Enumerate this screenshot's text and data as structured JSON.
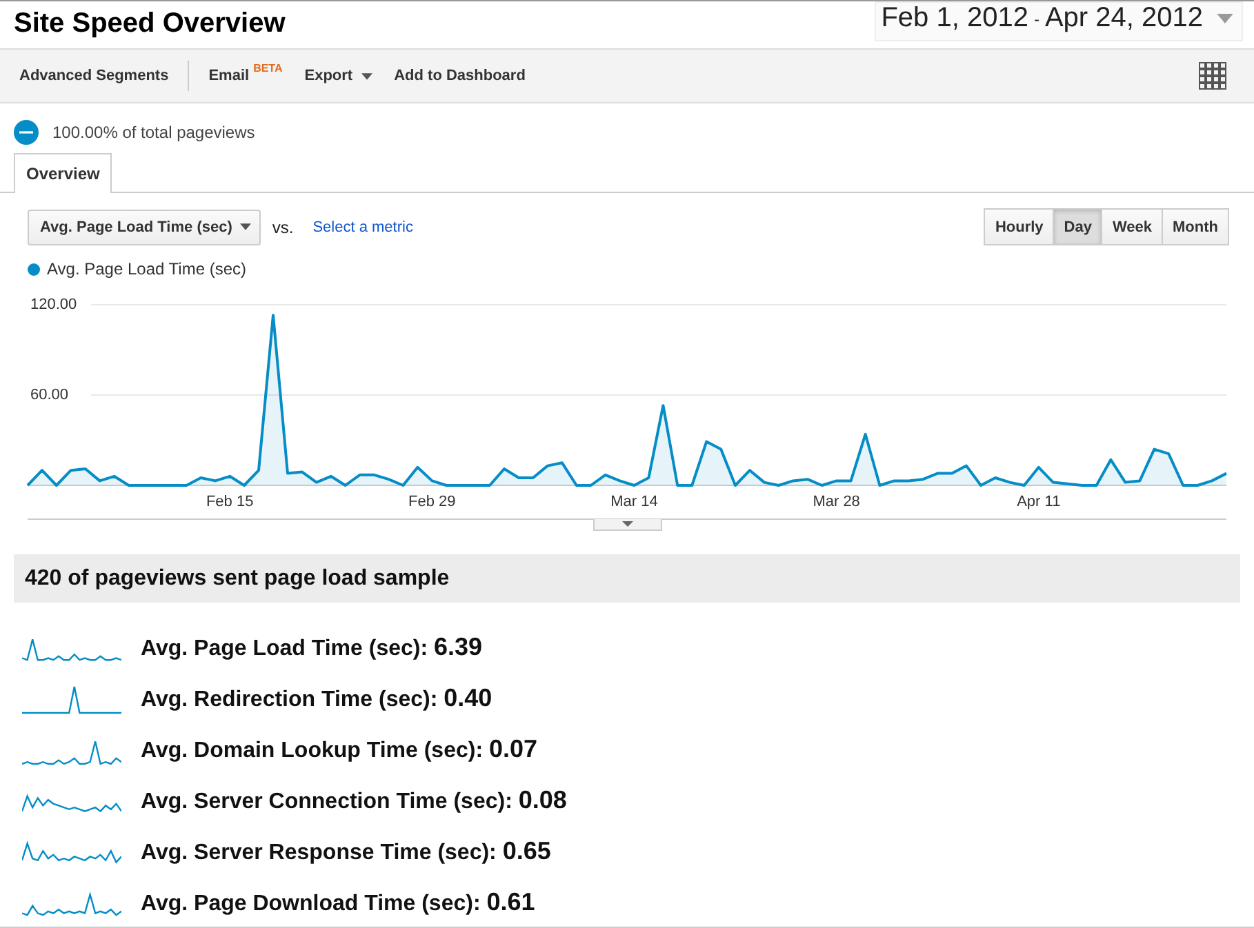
{
  "title": "Site Speed Overview",
  "date_range": {
    "start": "Feb 1, 2012",
    "separator": "-",
    "end": "Apr 24, 2012"
  },
  "toolbar": [
    {
      "label": "Advanced Segments",
      "kind": "plain"
    },
    {
      "label": "Email",
      "badge": "BETA",
      "kind": "badge"
    },
    {
      "label": "Export",
      "kind": "menu"
    },
    {
      "label": "Add to Dashboard",
      "kind": "plain"
    }
  ],
  "sample_share": "100.00% of total pageviews",
  "tabs": [
    {
      "label": "Overview",
      "selected": true
    }
  ],
  "metric_select": {
    "value": "Avg. Page Load Time (sec)",
    "vs": "vs.",
    "link": "Select a metric"
  },
  "granularity": [
    {
      "label": "Hourly",
      "selected": false
    },
    {
      "label": "Day",
      "selected": true
    },
    {
      "label": "Week",
      "selected": false
    },
    {
      "label": "Month",
      "selected": false
    }
  ],
  "chart": {
    "chart_data": {
      "type": "area",
      "categories": [
        null,
        null,
        null,
        null,
        null,
        null,
        null,
        null,
        null,
        null,
        null,
        null,
        null,
        null,
        "Feb 15",
        null,
        null,
        null,
        null,
        null,
        null,
        null,
        null,
        null,
        null,
        null,
        null,
        null,
        "Feb 29",
        null,
        null,
        null,
        null,
        null,
        null,
        null,
        null,
        null,
        null,
        null,
        null,
        null,
        "Mar 14",
        null,
        null,
        null,
        null,
        null,
        null,
        null,
        null,
        null,
        null,
        null,
        null,
        null,
        "Mar 28",
        null,
        null,
        null,
        null,
        null,
        null,
        null,
        null,
        null,
        null,
        null,
        null,
        null,
        "Apr 11",
        null,
        null,
        null,
        null,
        null,
        null,
        null,
        null,
        null,
        null,
        null,
        null,
        null
      ],
      "series": [
        {
          "name": "Avg. Page Load Time (sec)",
          "color": "#058dc7",
          "values": [
            0,
            10,
            0,
            10,
            11,
            3,
            6,
            0,
            0,
            0,
            0,
            0,
            5,
            3,
            6,
            0,
            10,
            113,
            8,
            9,
            2,
            6,
            0,
            7,
            7,
            4,
            0,
            12,
            3,
            0,
            0,
            0,
            0,
            11,
            5,
            5,
            13,
            15,
            0,
            0,
            7,
            3,
            0,
            5,
            53,
            0,
            0,
            29,
            24,
            0,
            10,
            2,
            0,
            3,
            4,
            0,
            3,
            3,
            34,
            0,
            3,
            3,
            4,
            8,
            8,
            13,
            0,
            5,
            2,
            0,
            12,
            2,
            1,
            0,
            0,
            17,
            2,
            3,
            24,
            21,
            0,
            0,
            3,
            8
          ]
        }
      ],
      "ylim": [
        0,
        120
      ],
      "yticks": [
        {
          "value": 60,
          "label": "60.00"
        },
        {
          "value": 120,
          "label": "120.00"
        }
      ]
    }
  },
  "summary": "420 of pageviews sent page load sample",
  "metrics": [
    {
      "label": "Avg. Page Load Time (sec):",
      "value": "6.39"
    },
    {
      "label": "Avg. Redirection Time (sec):",
      "value": "0.40"
    },
    {
      "label": "Avg. Domain Lookup Time (sec):",
      "value": "0.07"
    },
    {
      "label": "Avg. Server Connection Time (sec):",
      "value": "0.08"
    },
    {
      "label": "Avg. Server Response Time (sec):",
      "value": "0.65"
    },
    {
      "label": "Avg. Page Download Time (sec):",
      "value": "0.61"
    }
  ]
}
